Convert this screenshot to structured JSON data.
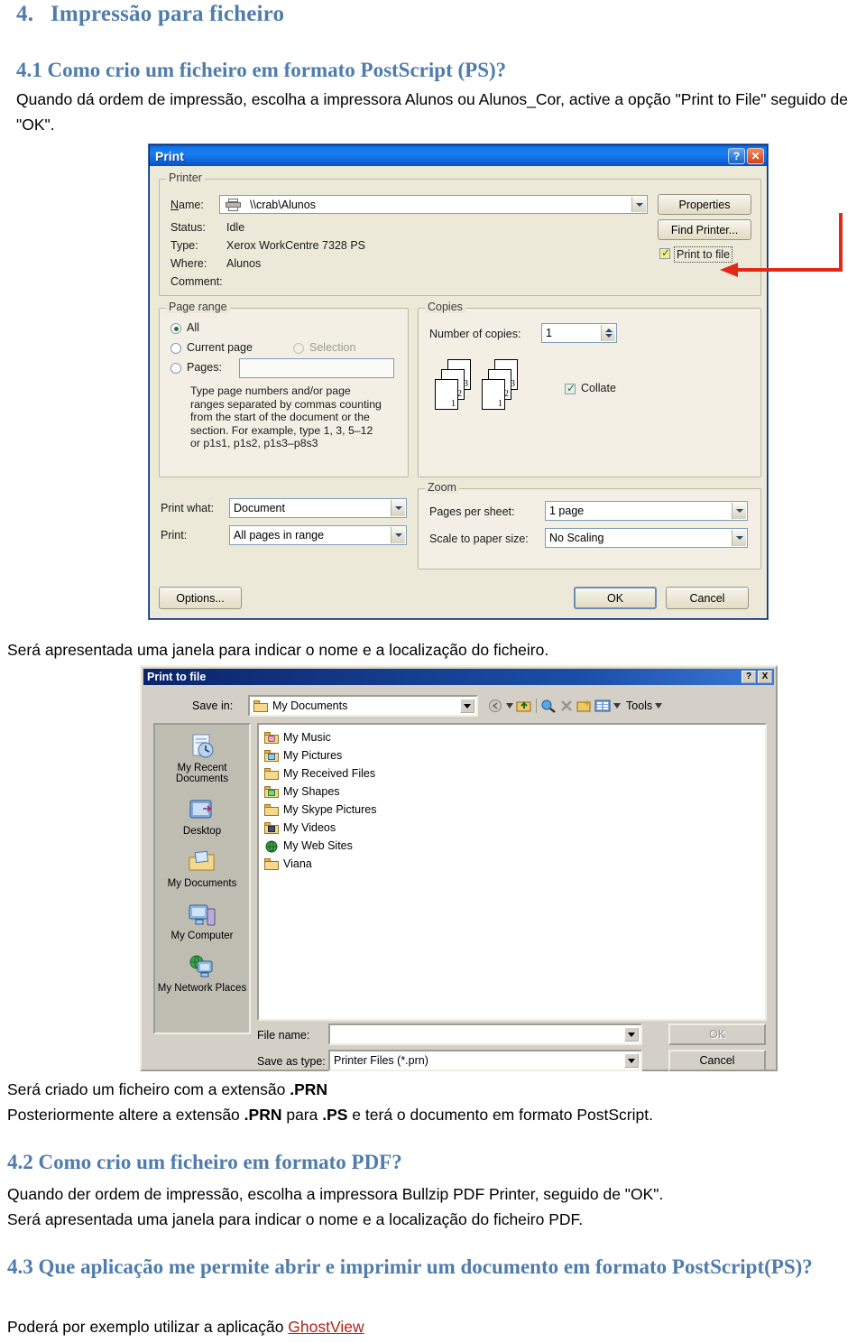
{
  "document": {
    "heading1_number": "4.",
    "heading1_text": "Impressão para ficheiro",
    "heading_4_1": "4.1 Como crio um ficheiro em formato PostScript (PS)?",
    "para_4_1": "Quando dá ordem de impressão, escolha a impressora Alunos ou Alunos_Cor, active a opção \"Print to File\" seguido de \"OK\".",
    "caption_after_print": "Será apresentada uma janela para indicar o nome e a localização do ficheiro.",
    "para_prn_1_a": "Será criado um ficheiro com a extensão ",
    "para_prn_1_b": ".PRN",
    "para_prn_2_a": "Posteriormente altere a extensão ",
    "para_prn_2_b": ".PRN",
    "para_prn_2_c": " para ",
    "para_prn_2_d": ".PS",
    "para_prn_2_e": " e terá o documento em formato PostScript.",
    "heading_4_2": "4.2 Como crio um ficheiro em formato PDF?",
    "para_4_2_line1": "Quando der ordem de impressão, escolha a impressora Bullzip PDF Printer, seguido de \"OK\".",
    "para_4_2_line2": "Será apresentada uma janela para indicar o nome e a localização do ficheiro PDF.",
    "heading_4_3": "4.3 Que aplicação me permite abrir e imprimir um documento em formato PostScript(PS)?",
    "para_4_3_a": "Poderá por exemplo utilizar a aplicação ",
    "para_4_3_link": "GhostView",
    "heading_color": "#4F7CAC",
    "link_color": "#B02418",
    "annotation_arrow_color": "#E02A16"
  },
  "print_dialog": {
    "title": "Print",
    "help_button": "?",
    "close_button": "✕",
    "printer_group": {
      "legend": "Printer",
      "name_label": "Name:",
      "name_value": "\\\\crab\\Alunos",
      "status_label": "Status:",
      "status_value": "Idle",
      "type_label": "Type:",
      "type_value": "Xerox WorkCentre 7328 PS",
      "where_label": "Where:",
      "where_value": "Alunos",
      "comment_label": "Comment:",
      "comment_value": "",
      "properties_button": "Properties",
      "find_printer_button": "Find Printer...",
      "print_to_file_label": "Print to file",
      "print_to_file_checked": true
    },
    "page_range_group": {
      "legend": "Page range",
      "all_label": "All",
      "all_selected": true,
      "current_page_label": "Current page",
      "selection_label": "Selection",
      "selection_disabled": true,
      "pages_label": "Pages:",
      "pages_value": "",
      "help_line1": "Type page numbers and/or page",
      "help_line2": "ranges separated by commas counting",
      "help_line3": "from the start of the document or the",
      "help_line4": "section. For example, type 1, 3, 5–12",
      "help_line5": "or p1s1, p1s2, p1s3–p8s3"
    },
    "copies_group": {
      "legend": "Copies",
      "number_label": "Number of copies:",
      "number_value": "1",
      "collate_label": "Collate",
      "collate_checked": true,
      "page_numbers": [
        "3",
        "2",
        "1"
      ]
    },
    "print_what_label": "Print what:",
    "print_what_value": "Document",
    "print_label": "Print:",
    "print_value": "All pages in range",
    "zoom_group": {
      "legend": "Zoom",
      "pages_per_sheet_label": "Pages per sheet:",
      "pages_per_sheet_value": "1 page",
      "scale_label": "Scale to paper size:",
      "scale_value": "No Scaling"
    },
    "options_button": "Options...",
    "ok_button": "OK",
    "cancel_button": "Cancel"
  },
  "print_to_file_dialog": {
    "title": "Print to file",
    "help_button": "?",
    "close_button": "X",
    "save_in_label": "Save in:",
    "save_in_value": "My Documents",
    "toolbar": {
      "back_label": "",
      "up_label": "",
      "search_label": "",
      "delete_label": "",
      "new_folder_label": "",
      "views_label": "",
      "tools_label": "Tools"
    },
    "places": [
      "My Recent Documents",
      "Desktop",
      "My Documents",
      "My Computer",
      "My Network Places"
    ],
    "files": [
      "My Music",
      "My Pictures",
      "My Received Files",
      "My Shapes",
      "My Skype Pictures",
      "My Videos",
      "My Web Sites",
      "Viana"
    ],
    "file_name_label": "File name:",
    "file_name_value": "",
    "save_as_type_label": "Save as type:",
    "save_as_type_value": "Printer Files (*.prn)",
    "ok_button": "OK",
    "ok_disabled": true,
    "cancel_button": "Cancel"
  }
}
